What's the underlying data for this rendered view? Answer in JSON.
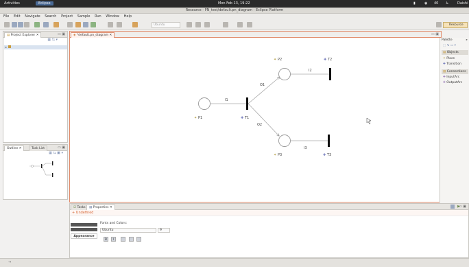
{
  "topbar": {
    "activities": "Activities",
    "app": "Eclipse",
    "clock": "Mon Feb 13, 19:22",
    "user": "Daishi",
    "volume": "40"
  },
  "window": {
    "title": "Resource - PN_test/default.pn_diagram - Eclipse Platform"
  },
  "menu": [
    "File",
    "Edit",
    "Navigate",
    "Search",
    "Project",
    "Sample",
    "Run",
    "Window",
    "Help"
  ],
  "toolbar": {
    "font_select": "Ubuntu",
    "perspective": "Resource"
  },
  "views": {
    "project_explorer": "Project Explorer",
    "outline": "Outline",
    "task_list": "Task List",
    "tasks": "Tasks",
    "properties": "Properties"
  },
  "editor": {
    "tab": "*default.pn_diagram",
    "places": [
      "P1",
      "P2",
      "P3"
    ],
    "transitions": [
      "T1",
      "T2",
      "T3"
    ],
    "arcs": [
      "I1",
      "O1",
      "O2",
      "I2",
      "I3"
    ]
  },
  "palette": {
    "title": "Palette",
    "groups": [
      {
        "name": "Objects",
        "items": [
          "Place",
          "Transition"
        ]
      },
      {
        "name": "Connections",
        "items": [
          "InputArc",
          "OutputArc"
        ]
      }
    ]
  },
  "properties": {
    "heading": "Undefined",
    "section_tab": "Appearance",
    "fonts_label": "Fonts and Colors:",
    "font_value": "Ubuntu",
    "size_value": "9"
  },
  "colors": {
    "accent": "#e18b6b",
    "marker": "#b7a14a",
    "node": "#888888"
  }
}
